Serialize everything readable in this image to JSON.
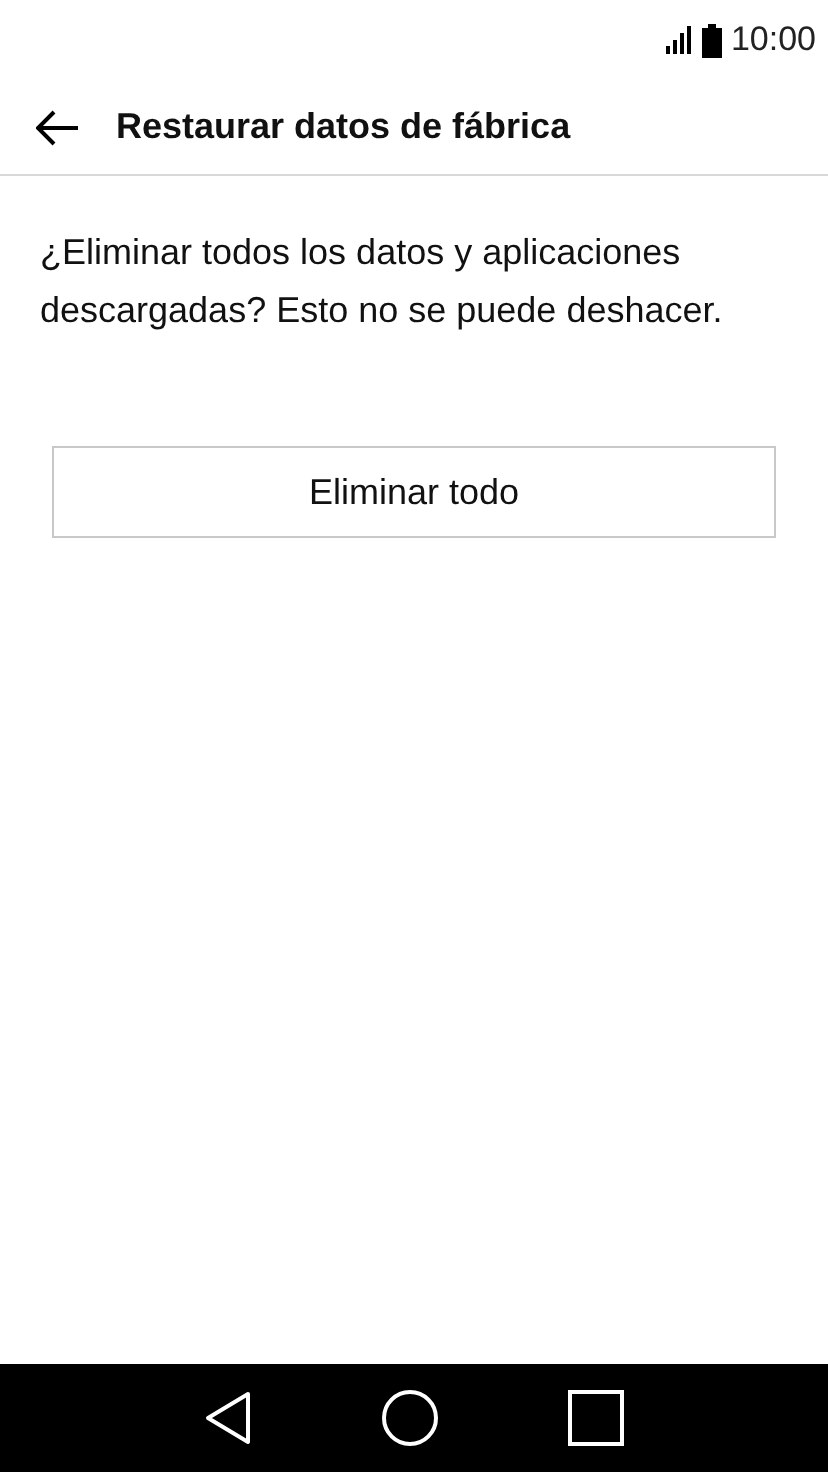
{
  "status_bar": {
    "time": "10:00"
  },
  "header": {
    "title": "Restaurar datos de fábrica"
  },
  "message": "¿Eliminar todos los datos y aplicaciones descargadas? Esto no se puede deshacer.",
  "button": {
    "label": "Eliminar todo"
  }
}
